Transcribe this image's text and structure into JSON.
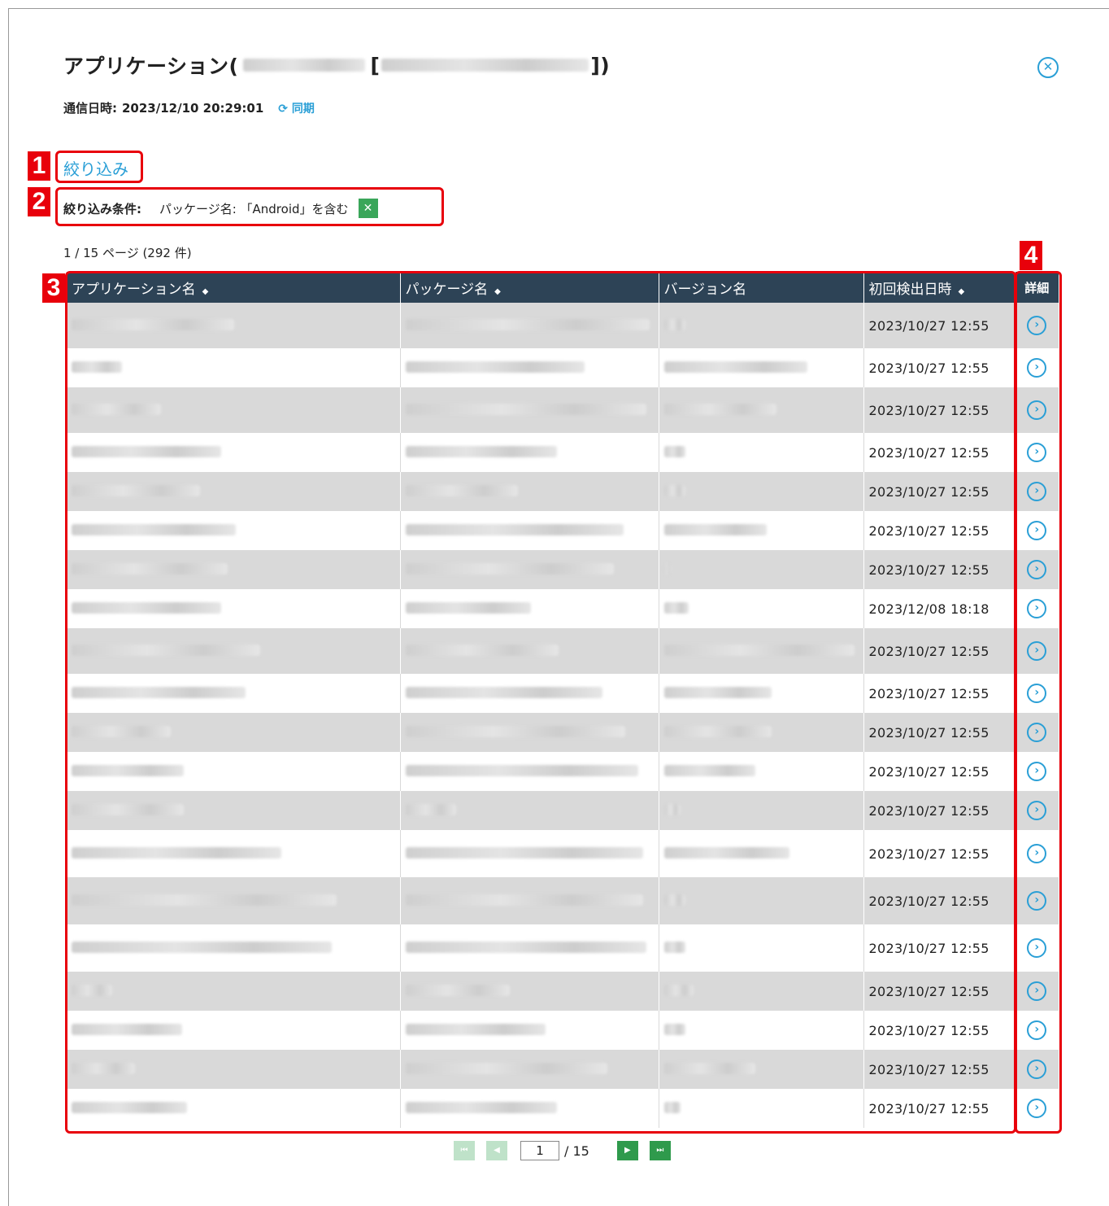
{
  "dialog": {
    "title_prefix": "アプリケーション(",
    "title_mid": " [",
    "title_suffix": "])",
    "sync_label": "通信日時:",
    "sync_time": "2023/12/10 20:29:01",
    "sync_link": "同期",
    "sync_icon": "refresh-icon",
    "close_icon": "close-icon"
  },
  "filter": {
    "link_label": "絞り込み",
    "condition_label": "絞り込み条件:",
    "condition_value": "パッケージ名: 「Android」を含む",
    "clear_icon": "clear-icon"
  },
  "annotations": {
    "badges": [
      "1",
      "2",
      "3",
      "4"
    ]
  },
  "page_info": "1 / 15 ページ (292 件)",
  "table": {
    "columns": [
      "アプリケーション名",
      "パッケージ名",
      "バージョン名",
      "初回検出日時",
      "詳細"
    ],
    "sortable": [
      true,
      true,
      false,
      true,
      false
    ],
    "rows": [
      {
        "first_detected": "2023/10/27 12:55"
      },
      {
        "first_detected": "2023/10/27 12:55"
      },
      {
        "first_detected": "2023/10/27 12:55"
      },
      {
        "first_detected": "2023/10/27 12:55"
      },
      {
        "first_detected": "2023/10/27 12:55"
      },
      {
        "first_detected": "2023/10/27 12:55"
      },
      {
        "first_detected": "2023/10/27 12:55"
      },
      {
        "first_detected": "2023/12/08 18:18"
      },
      {
        "first_detected": "2023/10/27 12:55"
      },
      {
        "first_detected": "2023/10/27 12:55"
      },
      {
        "first_detected": "2023/10/27 12:55"
      },
      {
        "first_detected": "2023/10/27 12:55"
      },
      {
        "first_detected": "2023/10/27 12:55"
      },
      {
        "first_detected": "2023/10/27 12:55"
      },
      {
        "first_detected": "2023/10/27 12:55"
      },
      {
        "first_detected": "2023/10/27 12:55"
      },
      {
        "first_detected": "2023/10/27 12:55"
      },
      {
        "first_detected": "2023/10/27 12:55"
      },
      {
        "first_detected": "2023/10/27 12:55"
      },
      {
        "first_detected": "2023/10/27 12:55"
      }
    ]
  },
  "pagination": {
    "current": "1",
    "total": "/ 15"
  },
  "colors": {
    "accent": "#2a9fd6",
    "header_bg": "#2d4356",
    "annotation_red": "#e8000b",
    "pager_green": "#2f9a4c"
  }
}
